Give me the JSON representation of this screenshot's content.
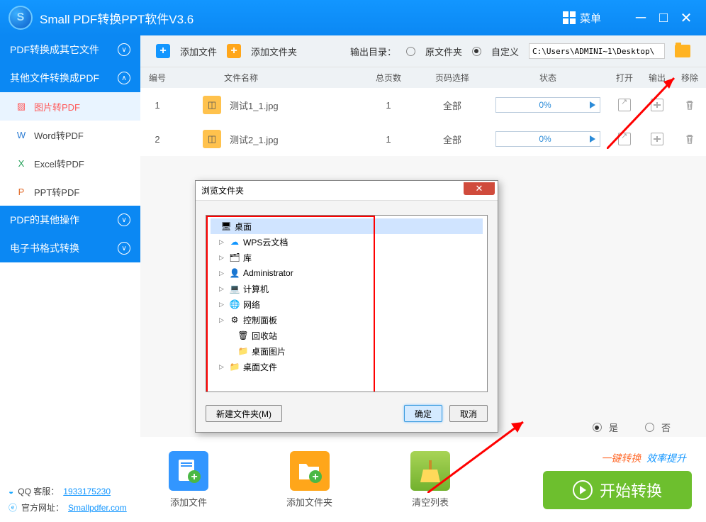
{
  "titlebar": {
    "app_title": "Small  PDF转换PPT软件V3.6",
    "menu_label": "菜单"
  },
  "sidebar": {
    "cat1": "PDF转换成其它文件",
    "cat2": "其他文件转换成PDF",
    "items": {
      "img2pdf": "图片转PDF",
      "word2pdf": "Word转PDF",
      "excel2pdf": "Excel转PDF",
      "ppt2pdf": "PPT转PDF"
    },
    "cat3": "PDF的其他操作",
    "cat4": "电子书格式转换",
    "qq_label": "QQ 客服：",
    "qq_number": "1933175230",
    "site_label": "官方网址：",
    "site_url": "Smallpdfer.com"
  },
  "toolbar": {
    "add_file": "添加文件",
    "add_folder": "添加文件夹",
    "output_dir": "输出目录：",
    "opt_source": "原文件夹",
    "opt_custom": "自定义",
    "path": "C:\\Users\\ADMINI~1\\Desktop\\"
  },
  "table": {
    "headers": {
      "num": "编号",
      "name": "文件名称",
      "pages": "总页数",
      "range": "页码选择",
      "status": "状态",
      "open": "打开",
      "output": "输出",
      "delete": "移除"
    },
    "rows": [
      {
        "num": "1",
        "name": "测试1_1.jpg",
        "pages": "1",
        "range": "全部",
        "progress": "0%"
      },
      {
        "num": "2",
        "name": "测试2_1.jpg",
        "pages": "1",
        "range": "全部",
        "progress": "0%"
      }
    ]
  },
  "merge": {
    "yes": "是",
    "no": "否"
  },
  "bottom": {
    "add_file": "添加文件",
    "add_folder": "添加文件夹",
    "clear_list": "清空列表",
    "tagline1": "一键转换",
    "tagline2": "效率提升",
    "start": "开始转换"
  },
  "dialog": {
    "title": "浏览文件夹",
    "nodes": {
      "desktop": "桌面",
      "wps": "WPS云文档",
      "lib": "库",
      "admin": "Administrator",
      "computer": "计算机",
      "network": "网络",
      "control": "控制面板",
      "recycle": "回收站",
      "pics": "桌面图片",
      "files": "桌面文件"
    },
    "new_folder": "新建文件夹(M)",
    "ok": "确定",
    "cancel": "取消"
  }
}
